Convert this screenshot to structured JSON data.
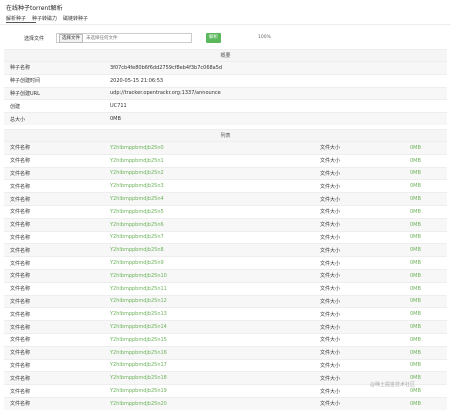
{
  "page": {
    "title": "在线种子torrent解析"
  },
  "tabs": [
    "解析种子",
    "种子转磁力",
    "磁链转种子"
  ],
  "upload": {
    "label": "选择文件",
    "button_label": "选择文件",
    "file_name": "未选择任何文件",
    "parse_label": "解析",
    "progress": "100%"
  },
  "summary": {
    "header": "概要",
    "rows": [
      {
        "label": "种子名称",
        "value": "3f07cb4fe80b6f6dd2759cf8eb4f3b7c068a5d"
      },
      {
        "label": "种子创建时间",
        "value": "2020-05-15 21:06:53"
      },
      {
        "label": "种子创建URL",
        "value": "udp://tracker.opentrackr.org:1337/announce"
      },
      {
        "label": "创建",
        "value": "UC711"
      },
      {
        "label": "总大小",
        "value": "0MB"
      }
    ]
  },
  "files": {
    "header": "列表",
    "name_label": "文件名称",
    "size_label": "文件大小",
    "rows": [
      {
        "name": "Y2hlbmppbmdjb25n0",
        "size": "0MB"
      },
      {
        "name": "Y2hlbmppbmdjb25n1",
        "size": "0MB"
      },
      {
        "name": "Y2hlbmppbmdjb25n2",
        "size": "0MB"
      },
      {
        "name": "Y2hlbmppbmdjb25n3",
        "size": "0MB"
      },
      {
        "name": "Y2hlbmppbmdjb25n4",
        "size": "0MB"
      },
      {
        "name": "Y2hlbmppbmdjb25n5",
        "size": "0MB"
      },
      {
        "name": "Y2hlbmppbmdjb25n6",
        "size": "0MB"
      },
      {
        "name": "Y2hlbmppbmdjb25n7",
        "size": "0MB"
      },
      {
        "name": "Y2hlbmppbmdjb25n8",
        "size": "0MB"
      },
      {
        "name": "Y2hlbmppbmdjb25n9",
        "size": "0MB"
      },
      {
        "name": "Y2hlbmppbmdjb25n10",
        "size": "0MB"
      },
      {
        "name": "Y2hlbmppbmdjb25n11",
        "size": "0MB"
      },
      {
        "name": "Y2hlbmppbmdjb25n12",
        "size": "0MB"
      },
      {
        "name": "Y2hlbmppbmdjb25n13",
        "size": "0MB"
      },
      {
        "name": "Y2hlbmppbmdjb25n14",
        "size": "0MB"
      },
      {
        "name": "Y2hlbmppbmdjb25n15",
        "size": "0MB"
      },
      {
        "name": "Y2hlbmppbmdjb25n16",
        "size": "0MB"
      },
      {
        "name": "Y2hlbmppbmdjb25n17",
        "size": "0MB"
      },
      {
        "name": "Y2hlbmppbmdjb25n18",
        "size": "0MB"
      },
      {
        "name": "Y2hlbmppbmdjb25n19",
        "size": "0MB"
      },
      {
        "name": "Y2hlbmppbmdjb25n20",
        "size": "0MB"
      }
    ]
  },
  "watermark": "@稀土掘金技术社区",
  "colors": {
    "accent_green": "#5cb85c",
    "file_name_green": "#6bb25a"
  }
}
